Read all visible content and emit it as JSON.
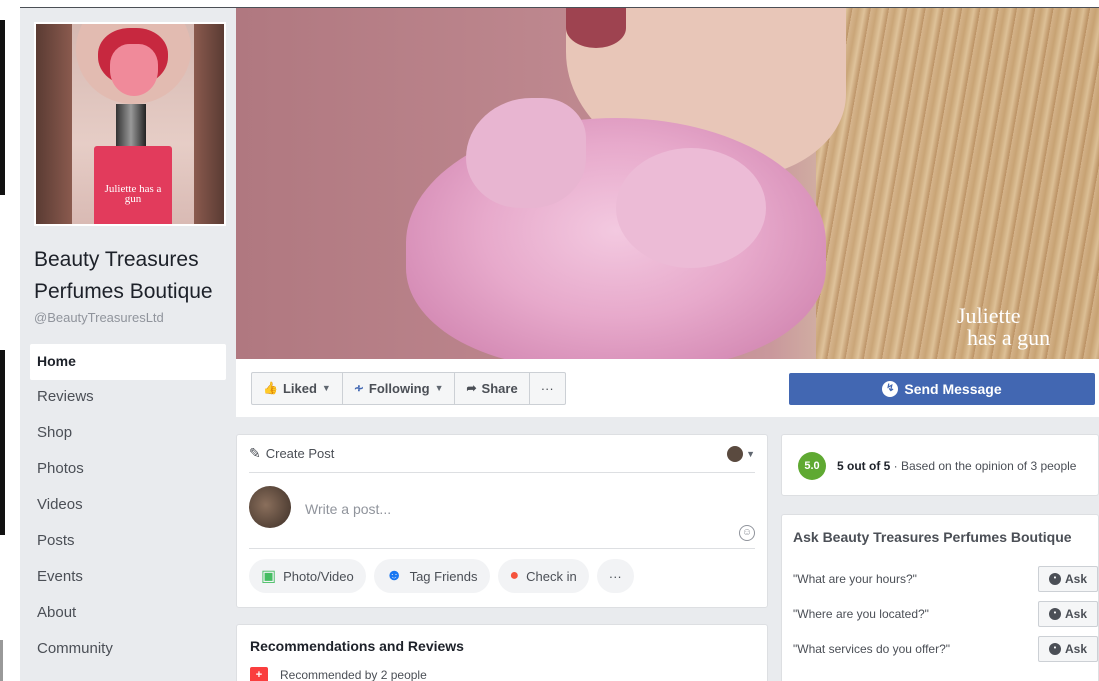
{
  "page": {
    "name": "Beauty Treasures Perfumes Boutique",
    "handle": "@BeautyTreasuresLtd",
    "profile_brand": "Juliette has a gun"
  },
  "nav": {
    "items": [
      {
        "label": "Home"
      },
      {
        "label": "Reviews"
      },
      {
        "label": "Shop"
      },
      {
        "label": "Photos"
      },
      {
        "label": "Videos"
      },
      {
        "label": "Posts"
      },
      {
        "label": "Events"
      },
      {
        "label": "About"
      },
      {
        "label": "Community"
      }
    ]
  },
  "cover": {
    "brand_line1": "Juliette",
    "brand_line2": "has a gun"
  },
  "actions": {
    "liked": "Liked",
    "following": "Following",
    "share": "Share",
    "more": "···",
    "send_message": "Send Message"
  },
  "composer": {
    "title": "Create Post",
    "placeholder": "Write a post...",
    "buttons": [
      {
        "label": "Photo/Video"
      },
      {
        "label": "Tag Friends"
      },
      {
        "label": "Check in"
      },
      {
        "label": "···"
      }
    ]
  },
  "reviews": {
    "title": "Recommendations and Reviews",
    "subtitle": "Recommended by 2 people"
  },
  "rating": {
    "score": "5.0",
    "summary": "5 out of 5",
    "detail": " · Based on the opinion of 3 people"
  },
  "ask": {
    "title": "Ask Beauty Treasures Perfumes Boutique",
    "questions": [
      {
        "text": "\"What are your hours?\"",
        "button": "Ask"
      },
      {
        "text": "\"Where are you located?\"",
        "button": "Ask"
      },
      {
        "text": "\"What services do you offer?\"",
        "button": "Ask"
      }
    ]
  },
  "colors": {
    "facebook_blue": "#4267b2",
    "rating_green": "#5fa932",
    "background": "#e9ebee"
  }
}
